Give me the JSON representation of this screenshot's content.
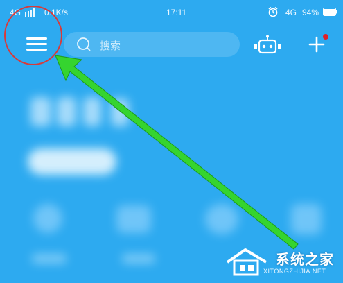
{
  "status_bar": {
    "network_left": "4G",
    "speed": "0.1K/s",
    "time": "17:11",
    "network_right": "4G",
    "battery": "94%"
  },
  "toolbar": {
    "search_placeholder": "搜索"
  },
  "watermark": {
    "title": "系统之家",
    "url": "XITONGZHIJIA.NET"
  },
  "colors": {
    "background": "#2daaf0",
    "annotation_circle": "#d83a3a",
    "annotation_arrow": "#35d42f",
    "notification_dot": "#e0202a"
  },
  "icons": [
    "menu-icon",
    "search-icon",
    "robot-icon",
    "plus-icon",
    "alarm-icon",
    "signal-icon",
    "battery-icon"
  ]
}
